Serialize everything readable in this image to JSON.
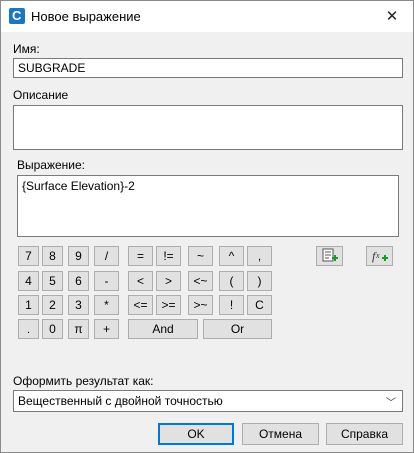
{
  "window": {
    "title": "Новое выражение",
    "app_glyph": "C",
    "close_glyph": "✕"
  },
  "name": {
    "label": "Имя:",
    "value": "SUBGRADE"
  },
  "description": {
    "label": "Описание",
    "value": ""
  },
  "expression": {
    "label": "Выражение:",
    "value": "{Surface Elevation}-2"
  },
  "keypad": {
    "row1": [
      "7",
      "8",
      "9",
      "/",
      "=",
      "!=",
      "~",
      "^",
      ","
    ],
    "row2": [
      "4",
      "5",
      "6",
      "-",
      "<",
      ">",
      "<~",
      "(",
      ")"
    ],
    "row3": [
      "1",
      "2",
      "3",
      "*",
      "<=",
      ">=",
      ">~",
      "!",
      "C"
    ],
    "row4": [
      ".",
      "0",
      "π",
      "+",
      "And",
      "Or"
    ]
  },
  "tools": {
    "insert_property": "insert-property-icon",
    "insert_function": "insert-function-icon"
  },
  "format": {
    "label": "Оформить результат как:",
    "selected": "Вещественный с двойной точностью",
    "arrow": "﹀"
  },
  "buttons": {
    "ok": "OK",
    "cancel": "Отмена",
    "help": "Справка"
  }
}
